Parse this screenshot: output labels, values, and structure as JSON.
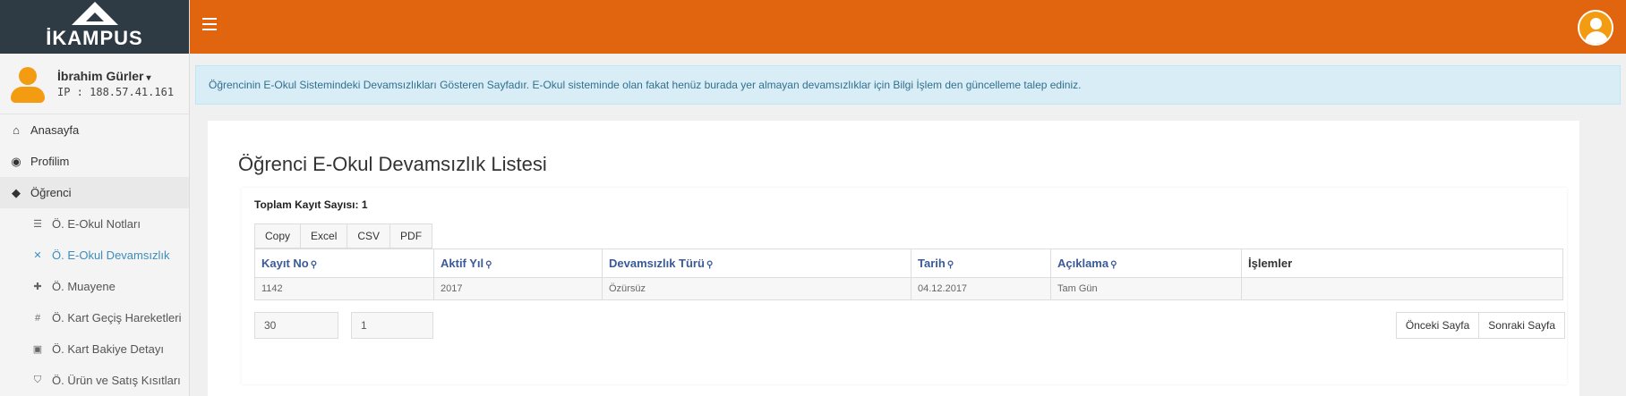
{
  "brand": {
    "name": "İKAMPUS"
  },
  "user": {
    "name": "İbrahim Gürler",
    "ip": "IP : 188.57.41.161"
  },
  "sidebar": {
    "items": [
      {
        "label": "Anasayfa",
        "icon": "home-icon"
      },
      {
        "label": "Profilim",
        "icon": "profile-icon"
      },
      {
        "label": "Öğrenci",
        "icon": "graduation-cap-icon"
      },
      {
        "label": "Ö. E-Okul Notları",
        "icon": "list-icon"
      },
      {
        "label": "Ö. E-Okul Devamsızlık",
        "icon": "close-icon"
      },
      {
        "label": "Ö. Muayene",
        "icon": "medical-icon"
      },
      {
        "label": "Ö. Kart Geçiş Hareketleri",
        "icon": "grid-icon"
      },
      {
        "label": "Ö. Kart Bakiye Detayı",
        "icon": "wallet-icon"
      },
      {
        "label": "Ö. Ürün ve Satış Kısıtları",
        "icon": "shield-icon"
      }
    ]
  },
  "info": {
    "text": "Öğrencinin E-Okul Sistemindeki Devamsızlıkları Gösteren Sayfadır. E-Okul sisteminde olan fakat henüz burada yer almayan devamsızlıklar için Bilgi İşlem den güncelleme talep ediniz."
  },
  "main": {
    "title": "Öğrenci E-Okul Devamsızlık Listesi",
    "total": "Toplam Kayıt Sayısı: 1",
    "export_buttons": [
      "Copy",
      "Excel",
      "CSV",
      "PDF"
    ],
    "columns": [
      "Kayıt No",
      "Aktif Yıl",
      "Devamsızlık Türü",
      "Tarih",
      "Açıklama",
      "İşlemler"
    ],
    "rows": [
      [
        "1142",
        "2017",
        "Özürsüz",
        "04.12.2017",
        "Tam Gün",
        ""
      ]
    ],
    "page_size": "30",
    "page_number": "1",
    "prev_label": "Önceki Sayfa",
    "next_label": "Sonraki Sayfa"
  },
  "colors": {
    "topbar": "#e1650f",
    "brand_bg": "#2e3b45",
    "active_link": "#3c8dbc",
    "header_link": "#3a5a99"
  }
}
